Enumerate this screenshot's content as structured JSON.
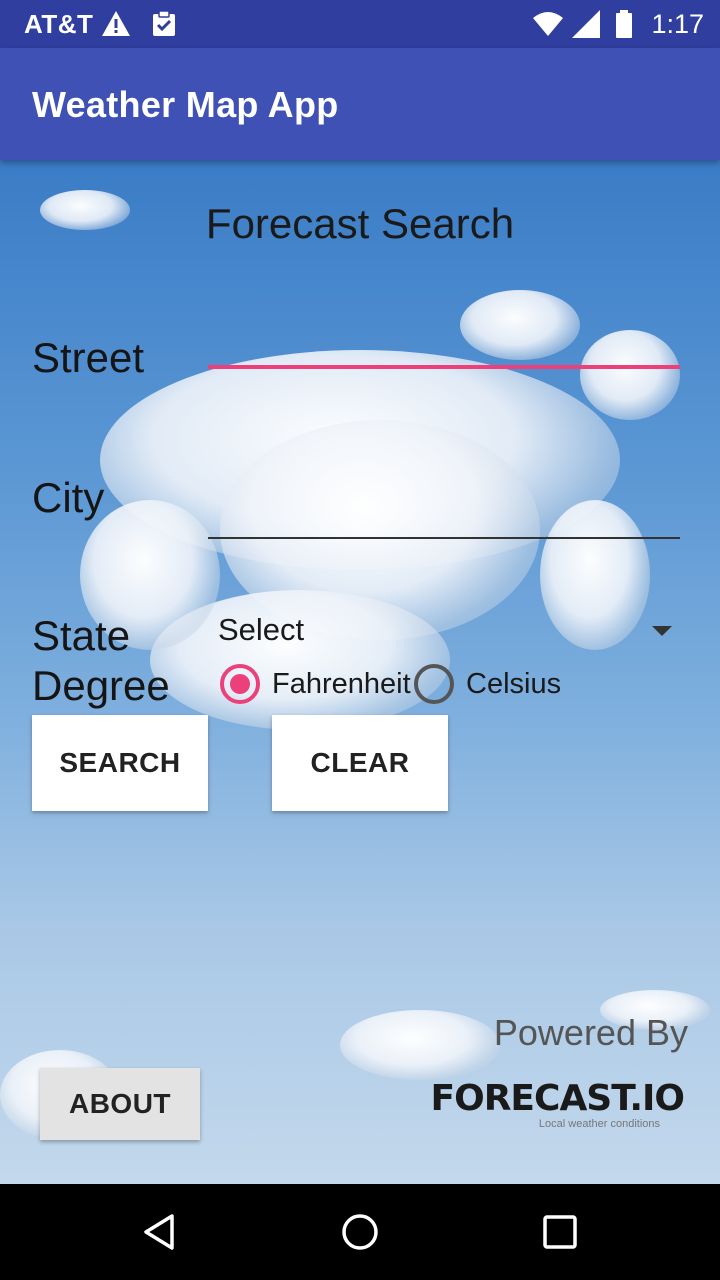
{
  "status_bar": {
    "carrier": "AT&T",
    "time": "1:17",
    "icons": [
      "warning-icon",
      "clipboard-check-icon",
      "wifi-icon",
      "signal-icon",
      "battery-icon"
    ]
  },
  "app_bar": {
    "title": "Weather Map App"
  },
  "form": {
    "heading": "Forecast Search",
    "street_label": "Street",
    "street_value": "",
    "city_label": "City",
    "city_value": "",
    "state_label": "State",
    "state_selected": "Select",
    "degree_label": "Degree",
    "degree_options": [
      {
        "label": "Fahrenheit",
        "selected": true
      },
      {
        "label": "Celsius",
        "selected": false
      }
    ],
    "search_button": "SEARCH",
    "clear_button": "CLEAR"
  },
  "footer": {
    "about_button": "ABOUT",
    "powered_by": "Powered By",
    "logo_text": "FORECAST.IO",
    "logo_tagline": "Local weather conditions"
  },
  "colors": {
    "status_bar": "#303F9F",
    "app_bar": "#3F51B5",
    "accent": "#EC407A"
  },
  "nav_bar": {
    "icons": [
      "back-icon",
      "home-icon",
      "recents-icon"
    ]
  }
}
